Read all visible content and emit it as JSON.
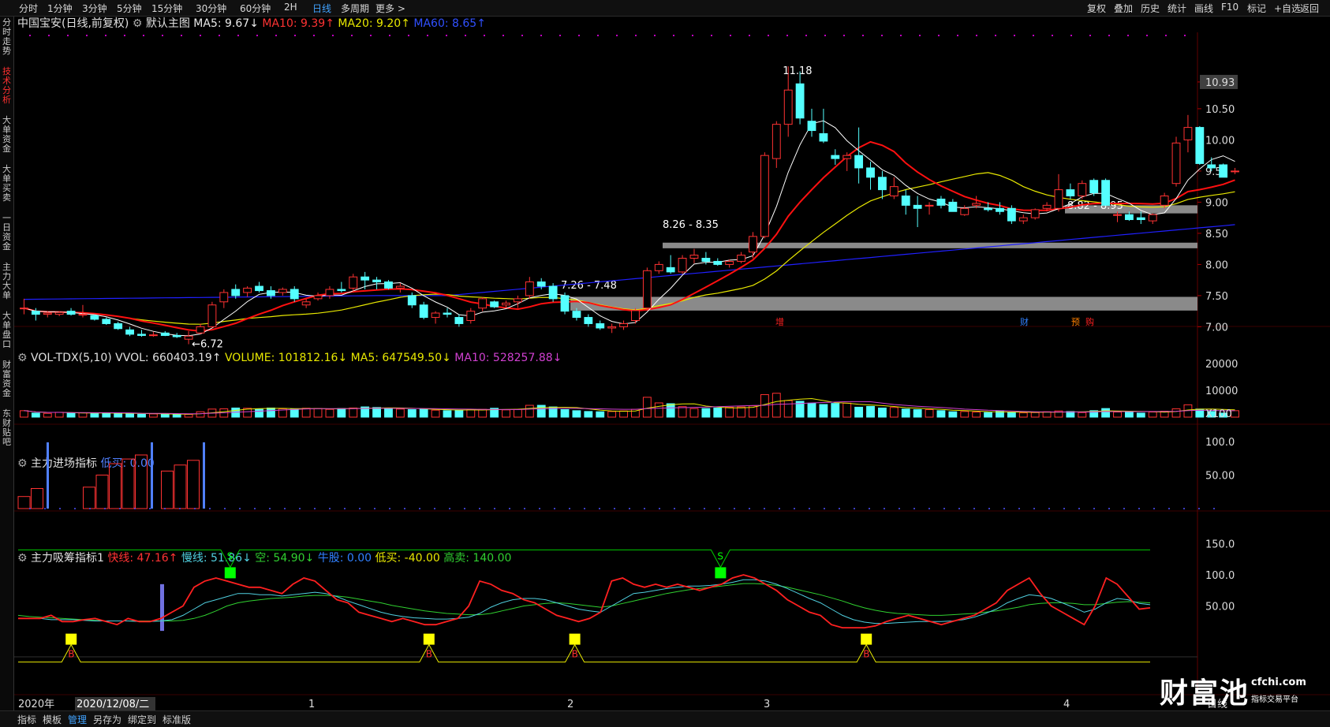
{
  "toolbar": {
    "left_items": [
      "分时",
      "1分钟",
      "3分钟",
      "5分钟",
      "15分钟",
      "30分钟",
      "60分钟",
      "2H",
      "日线",
      "多周期",
      "更多 >"
    ],
    "active_period": "日线",
    "right_items": [
      "复权",
      "叠加",
      "历史",
      "统计",
      "画线",
      "F10",
      "标记",
      "+自选",
      "返回"
    ]
  },
  "side_tabs": [
    "分时走势",
    "技术分析",
    "大单资金",
    "大单买卖",
    "一日资金",
    "主力大单",
    "大单盘口",
    "财富资金",
    "东财贴吧"
  ],
  "side_active": "技术分析",
  "main": {
    "title": "中国宝安(日线,前复权)",
    "template": "默认主图",
    "ma5": "MA5: 9.67↓",
    "ma10": "MA10: 9.39↑",
    "ma20": "MA20: 9.20↑",
    "ma60": "MA60: 8.65↑",
    "price_ticks": [
      "10.93",
      "10.50",
      "10.00",
      "9.50",
      "9.00",
      "8.50",
      "8.00",
      "7.50",
      "7.00"
    ],
    "current_price": "10.93",
    "annotations": {
      "high": "11.18",
      "low": "←6.72",
      "zone1": "7.26 - 7.48",
      "zone2": "8.26 - 8.35",
      "zone3": "8.82 - 8.95"
    },
    "events": [
      "增",
      "财",
      "预",
      "购"
    ]
  },
  "volume": {
    "title": "VOL-TDX(5,10)",
    "vvol": "VVOL: 660403.19↑",
    "volume": "VOLUME: 101812.16↓",
    "ma5": "MA5: 647549.50↓",
    "ma10": "MA10: 528257.88↓",
    "ticks": [
      "20000",
      "10000",
      "X100"
    ]
  },
  "ind1": {
    "title": "主力进场指标",
    "low_buy": "低买: 0.00",
    "ticks": [
      "100.0",
      "50.00"
    ]
  },
  "ind2": {
    "title": "主力吸筹指标1",
    "fast": "快线: 47.16↑",
    "slow": "慢线: 51.86↓",
    "empty": "空: 54.90↓",
    "bull": "牛股: 0.00",
    "low_buy": "低买: -40.00",
    "high_sell": "高卖: 140.00",
    "ticks": [
      "150.0",
      "100.0",
      "50.00"
    ],
    "signal_s": "S",
    "signal_b": "B"
  },
  "xaxis": {
    "start": "2020年",
    "cursor_date": "2020/12/08/二",
    "months": [
      "1",
      "2",
      "3",
      "4"
    ],
    "last": "日线"
  },
  "bottom_tabs": [
    "指标",
    "模板",
    "管理",
    "另存为",
    "绑定到",
    "标准版"
  ],
  "bottom_active": "管理",
  "watermark": {
    "brand": "财富池",
    "site": "cfchi.com",
    "slogan": "指标交易平台"
  },
  "chart_data": {
    "type": "candlestick",
    "candles": [
      [
        7.3,
        7.45,
        7.2,
        7.3
      ],
      [
        7.25,
        7.3,
        7.1,
        7.2
      ],
      [
        7.2,
        7.25,
        7.15,
        7.22
      ],
      [
        7.2,
        7.25,
        7.17,
        7.23
      ],
      [
        7.25,
        7.3,
        7.18,
        7.2
      ],
      [
        7.2,
        7.35,
        7.15,
        7.2
      ],
      [
        7.18,
        7.2,
        7.1,
        7.12
      ],
      [
        7.12,
        7.15,
        7.03,
        7.05
      ],
      [
        7.05,
        7.08,
        6.95,
        6.97
      ],
      [
        6.95,
        7.0,
        6.85,
        6.88
      ],
      [
        6.88,
        6.95,
        6.84,
        6.86
      ],
      [
        6.86,
        6.92,
        6.84,
        6.87
      ],
      [
        6.9,
        6.93,
        6.85,
        6.86
      ],
      [
        6.86,
        6.9,
        6.82,
        6.84
      ],
      [
        6.8,
        6.93,
        6.72,
        6.85
      ],
      [
        6.9,
        7.05,
        6.88,
        7.0
      ],
      [
        7.0,
        7.4,
        6.98,
        7.35
      ],
      [
        7.4,
        7.6,
        7.3,
        7.55
      ],
      [
        7.6,
        7.68,
        7.45,
        7.5
      ],
      [
        7.55,
        7.65,
        7.48,
        7.62
      ],
      [
        7.65,
        7.72,
        7.55,
        7.58
      ],
      [
        7.58,
        7.65,
        7.45,
        7.5
      ],
      [
        7.55,
        7.63,
        7.5,
        7.6
      ],
      [
        7.6,
        7.65,
        7.4,
        7.45
      ],
      [
        7.35,
        7.45,
        7.3,
        7.4
      ],
      [
        7.45,
        7.55,
        7.42,
        7.5
      ],
      [
        7.5,
        7.65,
        7.45,
        7.6
      ],
      [
        7.6,
        7.72,
        7.55,
        7.58
      ],
      [
        7.62,
        7.85,
        7.55,
        7.8
      ],
      [
        7.8,
        7.88,
        7.6,
        7.75
      ],
      [
        7.75,
        7.8,
        7.6,
        7.72
      ],
      [
        7.72,
        7.75,
        7.6,
        7.62
      ],
      [
        7.62,
        7.7,
        7.55,
        7.65
      ],
      [
        7.5,
        7.55,
        7.3,
        7.35
      ],
      [
        7.35,
        7.4,
        7.12,
        7.15
      ],
      [
        7.15,
        7.25,
        7.05,
        7.22
      ],
      [
        7.22,
        7.3,
        7.15,
        7.2
      ],
      [
        7.15,
        7.2,
        7.0,
        7.05
      ],
      [
        7.1,
        7.3,
        7.05,
        7.25
      ],
      [
        7.3,
        7.48,
        7.25,
        7.45
      ],
      [
        7.4,
        7.42,
        7.3,
        7.32
      ],
      [
        7.35,
        7.42,
        7.3,
        7.38
      ],
      [
        7.4,
        7.5,
        7.3,
        7.45
      ],
      [
        7.5,
        7.8,
        7.45,
        7.72
      ],
      [
        7.72,
        7.78,
        7.6,
        7.65
      ],
      [
        7.65,
        7.7,
        7.4,
        7.45
      ],
      [
        7.5,
        7.55,
        7.2,
        7.25
      ],
      [
        7.25,
        7.3,
        7.1,
        7.15
      ],
      [
        7.15,
        7.2,
        7.0,
        7.05
      ],
      [
        7.05,
        7.1,
        6.95,
        6.98
      ],
      [
        6.98,
        7.05,
        6.9,
        7.0
      ],
      [
        7.0,
        7.1,
        6.95,
        7.05
      ],
      [
        7.1,
        7.3,
        7.05,
        7.26
      ],
      [
        7.3,
        7.95,
        7.26,
        7.9
      ],
      [
        7.9,
        8.05,
        7.85,
        8.0
      ],
      [
        7.95,
        8.15,
        7.85,
        7.88
      ],
      [
        7.88,
        8.15,
        7.85,
        8.1
      ],
      [
        8.1,
        8.25,
        8.02,
        8.15
      ],
      [
        8.1,
        8.2,
        8.0,
        8.05
      ],
      [
        8.05,
        8.1,
        7.98,
        8.0
      ],
      [
        8.0,
        8.08,
        7.95,
        8.05
      ],
      [
        8.05,
        8.2,
        8.02,
        8.15
      ],
      [
        8.2,
        8.52,
        8.1,
        8.45
      ],
      [
        8.45,
        9.8,
        8.42,
        9.75
      ],
      [
        9.7,
        10.3,
        9.55,
        10.25
      ],
      [
        10.25,
        11.18,
        10.05,
        10.8
      ],
      [
        10.9,
        11.1,
        10.25,
        10.35
      ],
      [
        10.3,
        10.5,
        10.05,
        10.15
      ],
      [
        10.1,
        10.5,
        9.95,
        9.98
      ],
      [
        9.75,
        9.85,
        9.6,
        9.7
      ],
      [
        9.7,
        9.8,
        9.5,
        9.75
      ],
      [
        9.75,
        10.2,
        9.3,
        9.55
      ],
      [
        9.55,
        9.65,
        9.2,
        9.4
      ],
      [
        9.4,
        9.5,
        9.05,
        9.2
      ],
      [
        9.1,
        9.4,
        9.05,
        9.25
      ],
      [
        9.1,
        9.2,
        8.8,
        8.95
      ],
      [
        8.95,
        9.1,
        8.6,
        8.9
      ],
      [
        8.95,
        9.0,
        8.8,
        8.95
      ],
      [
        9.05,
        9.1,
        8.9,
        8.95
      ],
      [
        9.0,
        9.05,
        8.85,
        8.85
      ],
      [
        8.8,
        8.95,
        8.78,
        8.9
      ],
      [
        8.95,
        9.1,
        8.9,
        8.98
      ],
      [
        8.9,
        9.0,
        8.85,
        8.88
      ],
      [
        8.9,
        9.0,
        8.8,
        8.85
      ],
      [
        8.9,
        8.95,
        8.65,
        8.7
      ],
      [
        8.7,
        8.8,
        8.65,
        8.75
      ],
      [
        8.75,
        8.9,
        8.72,
        8.88
      ],
      [
        8.9,
        9.0,
        8.85,
        8.95
      ],
      [
        8.9,
        9.45,
        8.85,
        9.2
      ],
      [
        9.2,
        9.3,
        9.05,
        9.1
      ],
      [
        9.1,
        9.35,
        9.05,
        9.3
      ],
      [
        9.35,
        9.38,
        9.1,
        9.15
      ],
      [
        9.35,
        9.38,
        8.95,
        8.95
      ],
      [
        8.8,
        8.85,
        8.68,
        8.8
      ],
      [
        8.8,
        8.85,
        8.7,
        8.72
      ],
      [
        8.75,
        8.85,
        8.65,
        8.72
      ],
      [
        8.7,
        8.82,
        8.65,
        8.8
      ],
      [
        8.95,
        9.15,
        8.9,
        9.1
      ],
      [
        9.3,
        10.05,
        9.25,
        9.95
      ],
      [
        10.0,
        10.4,
        9.8,
        10.2
      ],
      [
        10.2,
        10.22,
        9.6,
        9.62
      ],
      [
        9.6,
        9.72,
        9.5,
        9.55
      ],
      [
        9.6,
        9.62,
        9.4,
        9.4
      ],
      [
        9.5,
        9.55,
        9.45,
        9.5
      ]
    ],
    "volume_hundreds": [
      2400,
      1500,
      1400,
      1800,
      1500,
      1600,
      1300,
      1600,
      1400,
      1300,
      1100,
      1200,
      1100,
      1000,
      1000,
      2000,
      3000,
      3100,
      3400,
      3300,
      3100,
      3400,
      3100,
      3000,
      3300,
      3200,
      2900,
      3200,
      3400,
      3800,
      3600,
      3200,
      3000,
      2800,
      3000,
      2600,
      2400,
      2500,
      2900,
      2900,
      3300,
      2700,
      2900,
      4400,
      4400,
      3800,
      2800,
      2400,
      2100,
      2000,
      2100,
      2300,
      2900,
      7400,
      5300,
      5000,
      3900,
      3200,
      3200,
      3400,
      3700,
      3800,
      4200,
      8400,
      8900,
      6200,
      5900,
      5200,
      4700,
      5100,
      5200,
      3700,
      4000,
      3400,
      3600,
      3000,
      2800,
      2800,
      2400,
      2000,
      2100,
      1900,
      1700,
      2200,
      1700,
      1600,
      1700,
      2000,
      2300,
      2100,
      1700,
      2400,
      3200,
      1900,
      1800,
      1500,
      1900,
      2200,
      3100,
      4600,
      3000,
      2100,
      1500,
      2400
    ],
    "ind1_values": [
      18,
      30,
      0,
      0,
      0,
      32,
      50,
      67,
      74,
      80,
      0,
      56,
      65,
      72,
      0
    ],
    "ind2_fast": [
      30,
      30,
      30,
      35,
      25,
      25,
      28,
      30,
      25,
      20,
      30,
      25,
      25,
      30,
      40,
      50,
      80,
      90,
      95,
      90,
      85,
      80,
      80,
      75,
      70,
      85,
      95,
      90,
      75,
      60,
      55,
      40,
      35,
      30,
      25,
      30,
      25,
      20,
      20,
      25,
      30,
      50,
      90,
      85,
      75,
      70,
      60,
      55,
      45,
      35,
      30,
      25,
      30,
      40,
      90,
      95,
      85,
      80,
      85,
      80,
      85,
      80,
      75,
      80,
      85,
      95,
      100,
      95,
      85,
      75,
      60,
      50,
      40,
      35,
      20,
      15,
      15,
      15,
      18,
      25,
      30,
      35,
      30,
      25,
      20,
      25,
      30,
      35,
      45,
      55,
      75,
      85,
      95,
      70,
      50,
      40,
      30,
      20,
      50,
      95,
      85,
      65,
      45,
      47
    ],
    "ind2_slow": [
      30,
      30,
      30,
      28,
      28,
      28,
      27,
      26,
      26,
      26,
      26,
      25,
      25,
      26,
      28,
      35,
      45,
      55,
      60,
      65,
      70,
      70,
      68,
      68,
      66,
      68,
      70,
      72,
      70,
      65,
      58,
      52,
      46,
      40,
      36,
      33,
      31,
      30,
      29,
      29,
      30,
      32,
      38,
      48,
      55,
      60,
      62,
      62,
      60,
      55,
      50,
      45,
      42,
      40,
      50,
      60,
      70,
      72,
      75,
      78,
      80,
      82,
      82,
      83,
      85,
      88,
      92,
      92,
      90,
      85,
      78,
      70,
      62,
      55,
      45,
      35,
      28,
      24,
      22,
      22,
      23,
      24,
      25,
      25,
      25,
      26,
      28,
      32,
      38,
      45,
      55,
      62,
      68,
      66,
      62,
      55,
      48,
      40,
      45,
      55,
      62,
      60,
      54,
      52
    ],
    "ind2_empty": [
      35,
      33,
      32,
      31,
      30,
      29,
      28,
      27,
      26,
      26,
      26,
      26,
      26,
      26,
      26,
      27,
      30,
      35,
      42,
      50,
      55,
      58,
      60,
      62,
      63,
      64,
      66,
      67,
      67,
      66,
      64,
      61,
      58,
      55,
      51,
      48,
      45,
      42,
      40,
      38,
      37,
      36,
      36,
      38,
      42,
      46,
      50,
      52,
      54,
      55,
      54,
      52,
      50,
      48,
      50,
      54,
      58,
      62,
      66,
      70,
      73,
      76,
      78,
      80,
      82,
      84,
      86,
      86,
      85,
      83,
      80,
      76,
      72,
      68,
      63,
      58,
      52,
      47,
      43,
      40,
      38,
      37,
      36,
      35,
      35,
      36,
      37,
      38,
      40,
      42,
      45,
      48,
      52,
      54,
      55,
      55,
      54,
      52,
      52,
      54,
      56,
      57,
      56,
      55
    ],
    "ind2_signals": [
      {
        "type": "S",
        "index": 16
      },
      {
        "type": "S",
        "index": 53
      },
      {
        "type": "B",
        "index": 4
      },
      {
        "type": "B",
        "index": 31
      },
      {
        "type": "B",
        "index": 42
      },
      {
        "type": "B",
        "index": 64
      }
    ]
  }
}
